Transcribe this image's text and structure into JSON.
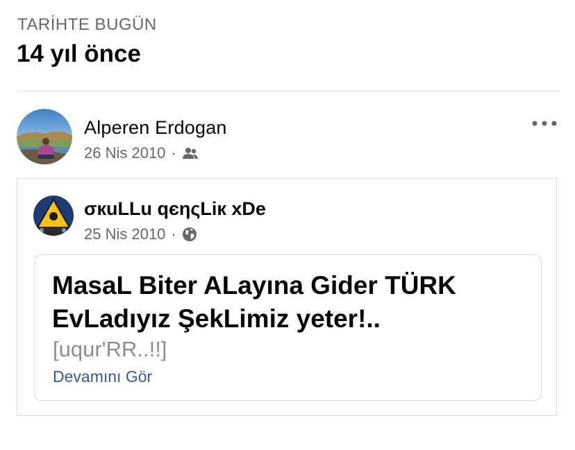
{
  "memories": {
    "section_label": "TARİHTE BUGÜN",
    "section_title": "14 yıl önce"
  },
  "post": {
    "author_name": "Alperen Erdogan",
    "date": "26 Nis 2010",
    "separator": "·",
    "audience_icon": "friends-icon",
    "more_icon": "more-horizontal-icon"
  },
  "shared_post": {
    "page_name": "σкuLLu qєηςLiк xDe",
    "date": "25 Nis 2010",
    "separator": "·",
    "audience_icon": "globe-icon",
    "headline": "MasaL Biter ALayına Gider TÜRK EvLadıyız ŞekLimiz yeter!..",
    "subtext": "[uqur'RR..!!]",
    "see_more": "Devamını Gör"
  },
  "colors": {
    "secondary_text": "#65676b",
    "link": "#385898",
    "border": "#d8dadf"
  }
}
